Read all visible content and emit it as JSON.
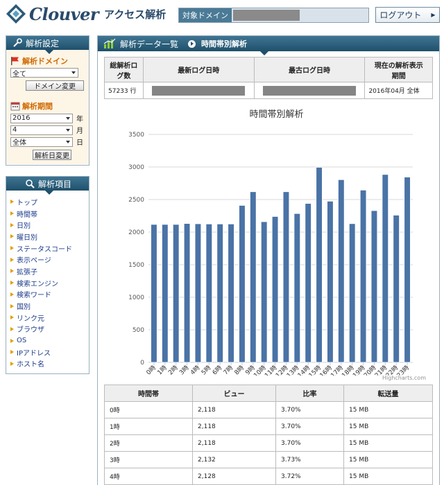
{
  "header": {
    "logo_text": "Clouver",
    "logo_sub": "アクセス解析",
    "domain_label": "対象ドメイン",
    "logout_label": "ログアウト"
  },
  "sidebar": {
    "settings_title": "解析設定",
    "domain_title": "解析ドメイン",
    "domain_select": "全て",
    "domain_button": "ドメイン変更",
    "period_title": "解析期間",
    "year_value": "2016",
    "year_unit": "年",
    "month_value": "4",
    "month_unit": "月",
    "day_value": "全体",
    "day_unit": "日",
    "period_button": "解析日変更",
    "menu_title": "解析項目",
    "menu_items": [
      "トップ",
      "時間帯",
      "日別",
      "曜日別",
      "ステータスコード",
      "表示ページ",
      "拡張子",
      "検索エンジン",
      "検索ワード",
      "国別",
      "リンク元",
      "ブラウザ",
      "OS",
      "IPアドレス",
      "ホスト名"
    ]
  },
  "main": {
    "title": "解析データ一覧",
    "breadcrumb_current": "時間帯別解析",
    "summary": {
      "headers": [
        "総解析ログ数",
        "最新ログ日時",
        "最古ログ日時",
        "現在の解析表示期間"
      ],
      "total_logs": "57233 行",
      "period": "2016年04月 全体"
    },
    "chart_credit": "Highcharts.com",
    "table": {
      "headers": [
        "時間帯",
        "ビュー",
        "比率",
        "転送量"
      ],
      "rows": [
        [
          "0時",
          "2,118",
          "3.70%",
          "15 MB"
        ],
        [
          "1時",
          "2,118",
          "3.70%",
          "15 MB"
        ],
        [
          "2時",
          "2,118",
          "3.70%",
          "15 MB"
        ],
        [
          "3時",
          "2,132",
          "3.73%",
          "15 MB"
        ],
        [
          "4時",
          "2,128",
          "3.72%",
          "15 MB"
        ]
      ]
    }
  },
  "chart_data": {
    "type": "bar",
    "title": "時間帯別解析",
    "categories": [
      "0時",
      "1時",
      "2時",
      "3時",
      "4時",
      "5時",
      "6時",
      "7時",
      "8時",
      "9時",
      "10時",
      "11時",
      "12時",
      "13時",
      "14時",
      "15時",
      "16時",
      "17時",
      "18時",
      "19時",
      "20時",
      "21時",
      "22時",
      "23時"
    ],
    "values": [
      2118,
      2118,
      2118,
      2132,
      2128,
      2125,
      2125,
      2125,
      2410,
      2620,
      2160,
      2240,
      2620,
      2285,
      2440,
      2995,
      2475,
      2805,
      2130,
      2645,
      2330,
      2885,
      2260,
      2845
    ],
    "ylim": [
      0,
      3500
    ],
    "yticks": [
      0,
      500,
      1000,
      1500,
      2000,
      2500,
      3000,
      3500
    ],
    "grid": true,
    "legend": "none",
    "bar_color": "#4a73a6"
  }
}
